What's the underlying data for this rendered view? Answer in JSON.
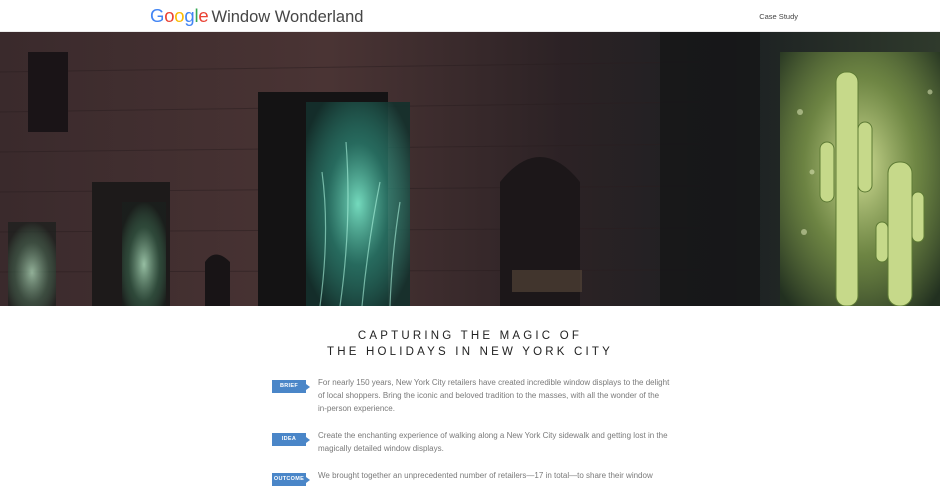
{
  "header": {
    "google_letters": [
      "G",
      "o",
      "o",
      "g",
      "l",
      "e"
    ],
    "title": "Window Wonderland",
    "nav_link": "Case Study"
  },
  "hero": {
    "description_icon": "photo-night-storefront-windows",
    "colors": {
      "accent_teal": "#4fd6b4",
      "accent_green": "#b9d77b"
    }
  },
  "headline": {
    "line1": "CAPTURING THE MAGIC OF",
    "line2": "THE HOLIDAYS IN NEW YORK CITY"
  },
  "items": [
    {
      "tag": "BRIEF",
      "text": "For nearly 150 years, New York City retailers have created incredible window displays to the delight of local shoppers. Bring the iconic and beloved tradition to the masses, with all the wonder of the in-person experience."
    },
    {
      "tag": "IDEA",
      "text": "Create the enchanting experience of walking along a New York City sidewalk and getting lost in the magically detailed window displays."
    },
    {
      "tag": "OUTCOME",
      "text": "We brought together an unprecedented number of retailers—17 in total—to share their window"
    }
  ],
  "colors": {
    "tag_blue": "#4a86c8",
    "google_blue": "#4285F4",
    "google_red": "#EA4335",
    "google_yellow": "#FBBC05",
    "google_green": "#34A853"
  }
}
